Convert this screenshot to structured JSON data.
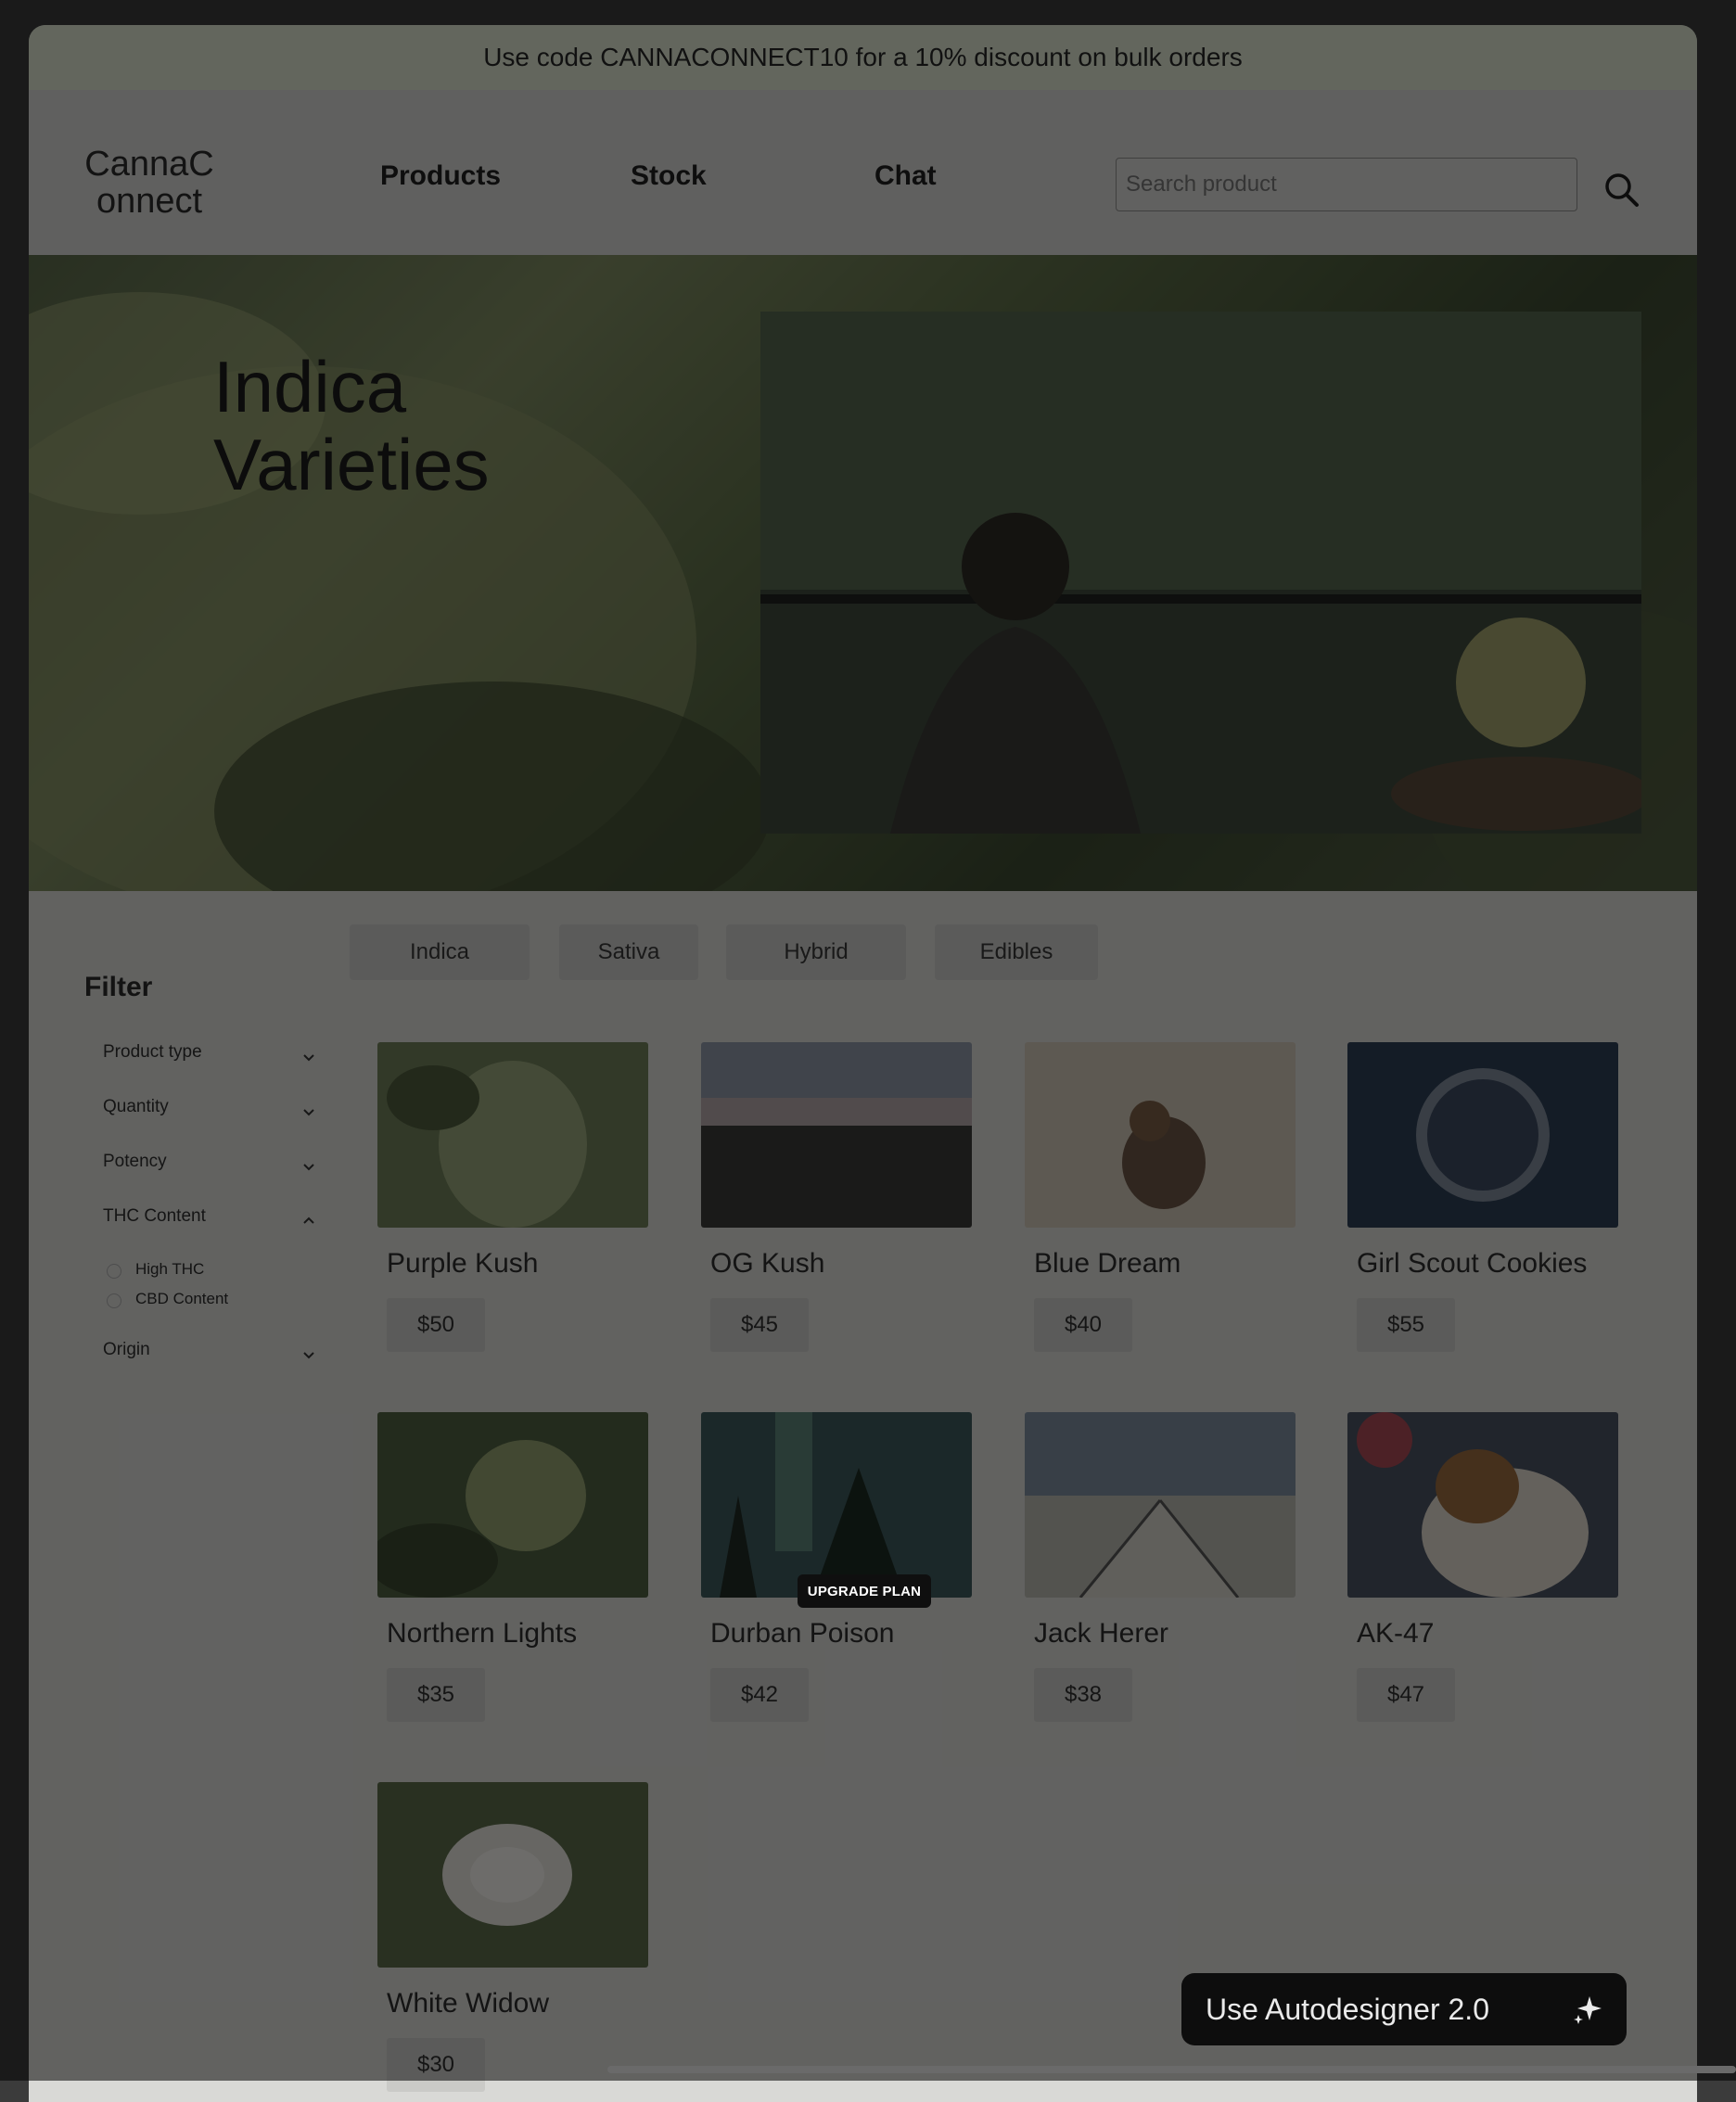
{
  "promo": {
    "text": "Use code CANNACONNECT10 for a 10% discount on bulk orders"
  },
  "header": {
    "logo": "CannaConnect",
    "nav": [
      "Products",
      "Stock",
      "Chat"
    ],
    "search_placeholder": "Search product"
  },
  "hero": {
    "title_line1": "Indica",
    "title_line2": "Varieties"
  },
  "filter": {
    "title": "Filter",
    "groups": [
      {
        "label": "Product type",
        "expanded": false
      },
      {
        "label": "Quantity",
        "expanded": false
      },
      {
        "label": "Potency",
        "expanded": false
      },
      {
        "label": "THC Content",
        "expanded": true,
        "options": [
          "High THC",
          "CBD Content"
        ]
      },
      {
        "label": "Origin",
        "expanded": false
      }
    ]
  },
  "tabs": [
    "Indica",
    "Sativa",
    "Hybrid",
    "Edibles"
  ],
  "products": [
    {
      "name": "Purple Kush",
      "price": "$50"
    },
    {
      "name": "OG Kush",
      "price": "$45"
    },
    {
      "name": "Blue Dream",
      "price": "$40"
    },
    {
      "name": "Girl Scout Cookies",
      "price": "$55"
    },
    {
      "name": "Northern Lights",
      "price": "$35"
    },
    {
      "name": "Durban Poison",
      "price": "$42"
    },
    {
      "name": "Jack Herer",
      "price": "$38"
    },
    {
      "name": "AK-47",
      "price": "$47"
    },
    {
      "name": "White Widow",
      "price": "$30"
    }
  ],
  "overlay": {
    "upgrade_label": "UPGRADE PLAN",
    "autodesigner_label": "Use Autodesigner 2.0"
  },
  "colors": {
    "promo_bg": "#dbe3cf",
    "modal_button": "#0d0d0d"
  }
}
